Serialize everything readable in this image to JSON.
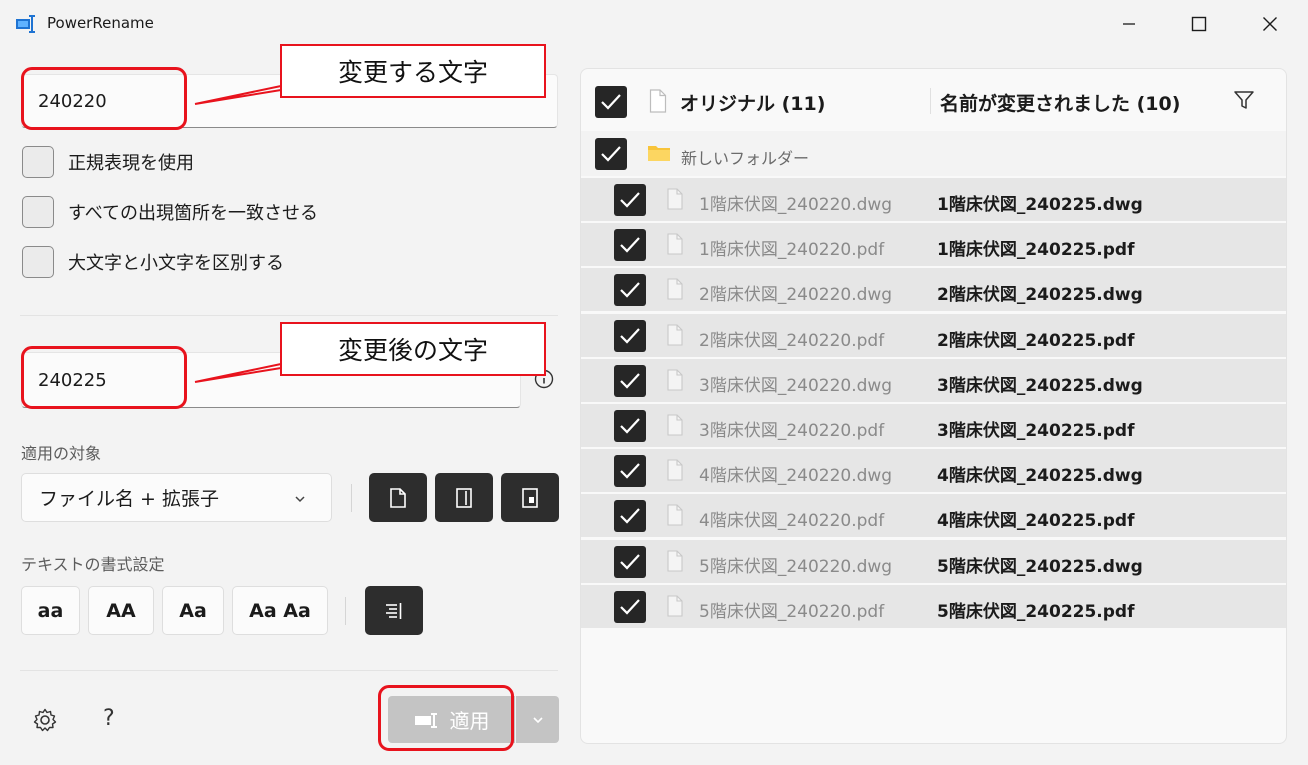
{
  "window": {
    "title": "PowerRename",
    "minimize": "—",
    "maximize": "☐",
    "close": "✕"
  },
  "search": {
    "value": "240220",
    "callout": "変更する文字"
  },
  "options": [
    {
      "label": "正規表現を使用",
      "checked": false
    },
    {
      "label": "すべての出現箇所を一致させる",
      "checked": false
    },
    {
      "label": "大文字と小文字を区別する",
      "checked": false
    }
  ],
  "replace": {
    "value": "240225",
    "callout": "変更後の文字"
  },
  "apply_to": {
    "label": "適用の対象",
    "selected": "ファイル名 + 拡張子"
  },
  "text_format": {
    "label": "テキストの書式設定",
    "buttons": [
      "aa",
      "AA",
      "Aa",
      "Aa Aa"
    ]
  },
  "footer": {
    "help": "?",
    "apply_label": "適用"
  },
  "list": {
    "header_original": "オリジナル (11)",
    "header_renamed": "名前が変更されました (10)",
    "folder": "新しいフォルダー",
    "rows": [
      {
        "original": "1階床伏図_240220.dwg",
        "renamed": "1階床伏図_240225.dwg"
      },
      {
        "original": "1階床伏図_240220.pdf",
        "renamed": "1階床伏図_240225.pdf"
      },
      {
        "original": "2階床伏図_240220.dwg",
        "renamed": "2階床伏図_240225.dwg"
      },
      {
        "original": "2階床伏図_240220.pdf",
        "renamed": "2階床伏図_240225.pdf"
      },
      {
        "original": "3階床伏図_240220.dwg",
        "renamed": "3階床伏図_240225.dwg"
      },
      {
        "original": "3階床伏図_240220.pdf",
        "renamed": "3階床伏図_240225.pdf"
      },
      {
        "original": "4階床伏図_240220.dwg",
        "renamed": "4階床伏図_240225.dwg"
      },
      {
        "original": "4階床伏図_240220.pdf",
        "renamed": "4階床伏図_240225.pdf"
      },
      {
        "original": "5階床伏図_240220.dwg",
        "renamed": "5階床伏図_240225.dwg"
      },
      {
        "original": "5階床伏図_240220.pdf",
        "renamed": "5階床伏図_240225.pdf"
      }
    ]
  },
  "colors": {
    "accent_red": "#e8131d",
    "checkbox_dark": "#262626",
    "folder_yellow": "#f8c43a"
  }
}
